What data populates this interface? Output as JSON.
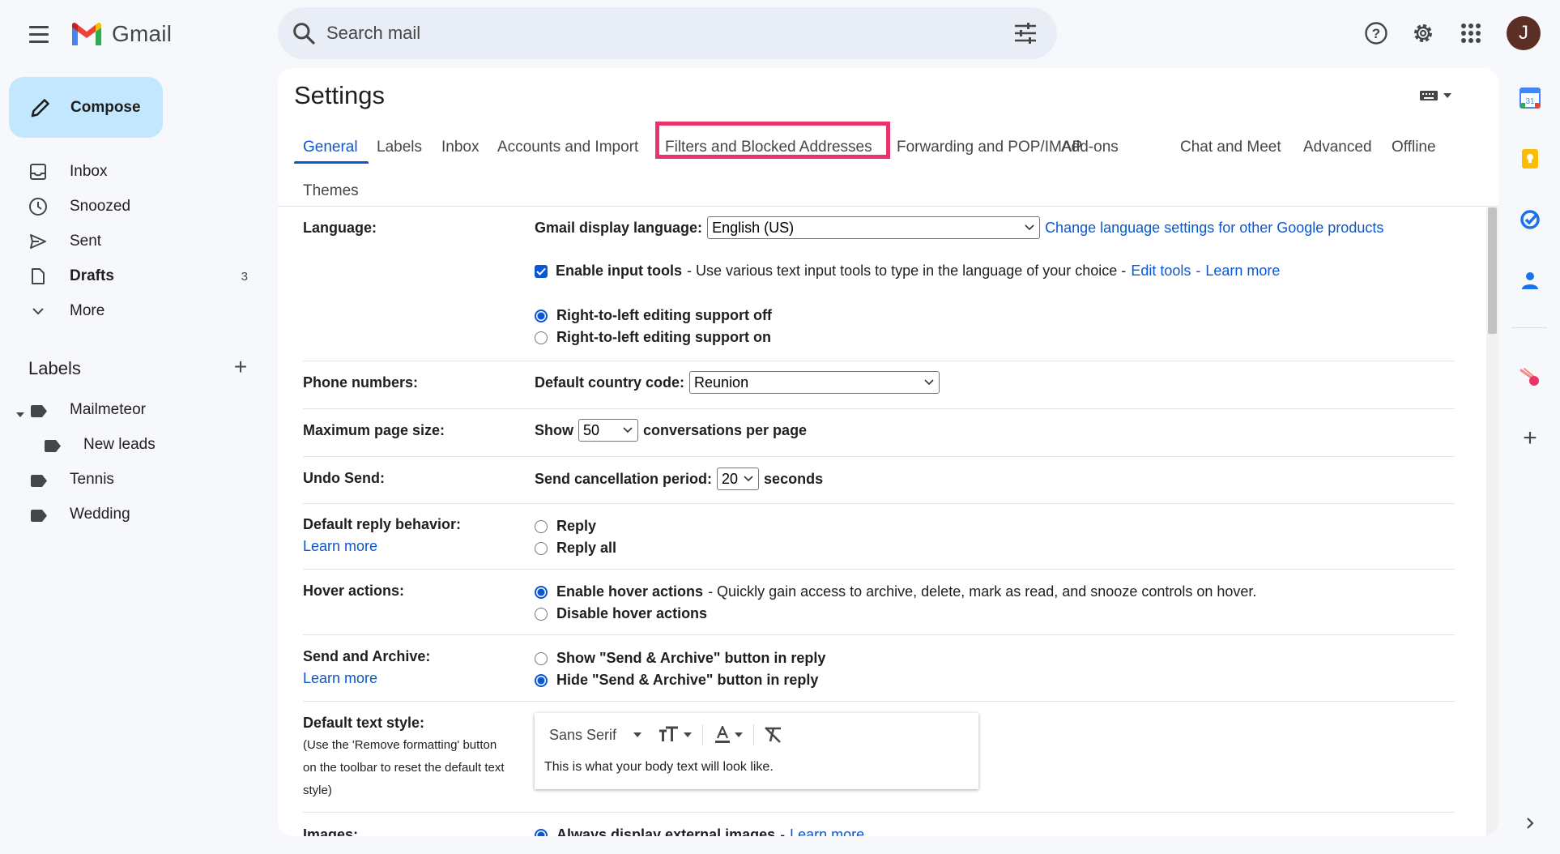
{
  "header": {
    "app_name": "Gmail",
    "search_placeholder": "Search mail",
    "avatar_initial": "J",
    "icons": [
      "menu-icon",
      "search-icon",
      "tune-icon",
      "help-icon",
      "gear-icon",
      "apps-icon"
    ]
  },
  "sidebar": {
    "compose_label": "Compose",
    "items": [
      {
        "label": "Inbox",
        "icon": "inbox-icon",
        "count": ""
      },
      {
        "label": "Snoozed",
        "icon": "clock-icon",
        "count": ""
      },
      {
        "label": "Sent",
        "icon": "send-icon",
        "count": ""
      },
      {
        "label": "Drafts",
        "icon": "draft-icon",
        "count": "3"
      },
      {
        "label": "More",
        "icon": "chevron-down-icon",
        "count": ""
      }
    ],
    "labels_title": "Labels",
    "labels": [
      {
        "label": "Mailmeteor"
      },
      {
        "label": "New leads"
      },
      {
        "label": "Tennis"
      },
      {
        "label": "Wedding"
      }
    ]
  },
  "settings": {
    "title": "Settings",
    "tabs": [
      {
        "label": "General"
      },
      {
        "label": "Labels"
      },
      {
        "label": "Inbox"
      },
      {
        "label": "Accounts and Import"
      },
      {
        "label": "Filters and Blocked Addresses"
      },
      {
        "label": "Forwarding and POP/IMAP"
      },
      {
        "label": "Add-ons"
      },
      {
        "label": "Chat and Meet"
      },
      {
        "label": "Advanced"
      },
      {
        "label": "Offline"
      },
      {
        "label": "Themes"
      }
    ],
    "active_tab": "General",
    "highlighted_tab": "Filters and Blocked Addresses",
    "language": {
      "label": "Language:",
      "display_label": "Gmail display language:",
      "display_value": "English (US)",
      "change_link": "Change language settings for other Google products",
      "input_tools_label": "Enable input tools",
      "input_tools_desc": "- Use various text input tools to type in the language of your choice -",
      "edit_tools_link": "Edit tools",
      "learn_more_link": "Learn more",
      "rtl_off": "Right-to-left editing support off",
      "rtl_on": "Right-to-left editing support on"
    },
    "phone": {
      "label": "Phone numbers:",
      "country_label": "Default country code:",
      "country_value": "Reunion"
    },
    "page_size": {
      "label": "Maximum page size:",
      "show": "Show",
      "value": "50",
      "suffix": "conversations per page"
    },
    "undo_send": {
      "label": "Undo Send:",
      "period_label": "Send cancellation period:",
      "value": "20",
      "suffix": "seconds"
    },
    "reply": {
      "label": "Default reply behavior:",
      "learn_more": "Learn more",
      "opt1": "Reply",
      "opt2": "Reply all"
    },
    "hover": {
      "label": "Hover actions:",
      "enable": "Enable hover actions",
      "enable_desc": "- Quickly gain access to archive, delete, mark as read, and snooze controls on hover.",
      "disable": "Disable hover actions"
    },
    "send_archive": {
      "label": "Send and Archive:",
      "learn_more": "Learn more",
      "show": "Show \"Send & Archive\" button in reply",
      "hide": "Hide \"Send & Archive\" button in reply"
    },
    "text_style": {
      "label": "Default text style:",
      "note1": "(Use the 'Remove formatting' button",
      "note2": "on the toolbar to reset the default text",
      "note3": "style)",
      "font": "Sans Serif",
      "preview": "This is what your body text will look like."
    },
    "images": {
      "label": "Images:",
      "always": "Always display external images",
      "learn_more": "Learn more"
    }
  },
  "colors": {
    "accent": "#0b57d0",
    "compose_bg": "#c2e7ff",
    "highlight": "#e8336b",
    "background": "#f6f8fc"
  }
}
